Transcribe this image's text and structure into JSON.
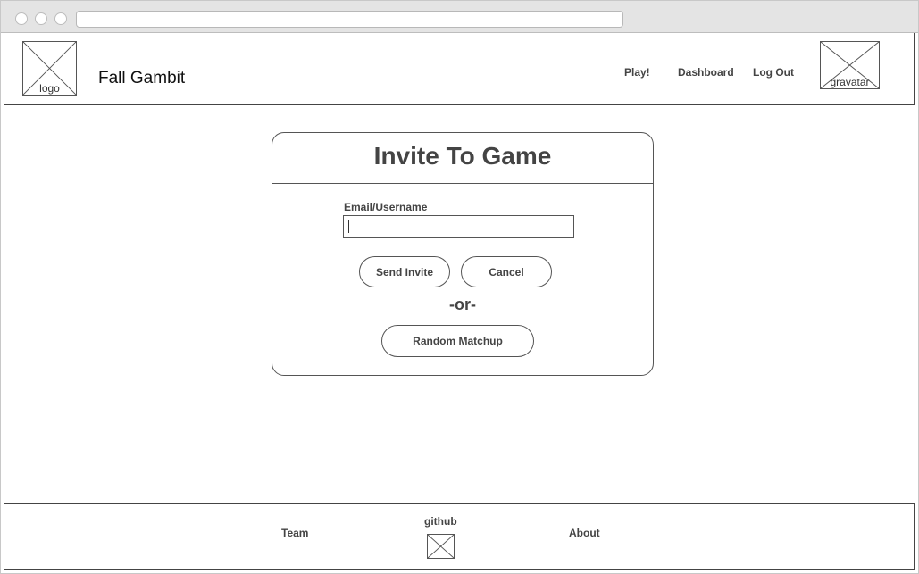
{
  "header": {
    "logo_caption": "logo",
    "brand": "Fall Gambit",
    "nav": {
      "play": "Play!",
      "dashboard": "Dashboard",
      "logout": "Log Out"
    },
    "gravatar_caption": "gravatar"
  },
  "invite": {
    "title": "Invite To Game",
    "field_label": "Email/Username",
    "field_value": "",
    "send_label": "Send Invite",
    "cancel_label": "Cancel",
    "or_text": "-or-",
    "random_label": "Random Matchup"
  },
  "footer": {
    "team": "Team",
    "github": "github",
    "about": "About"
  }
}
